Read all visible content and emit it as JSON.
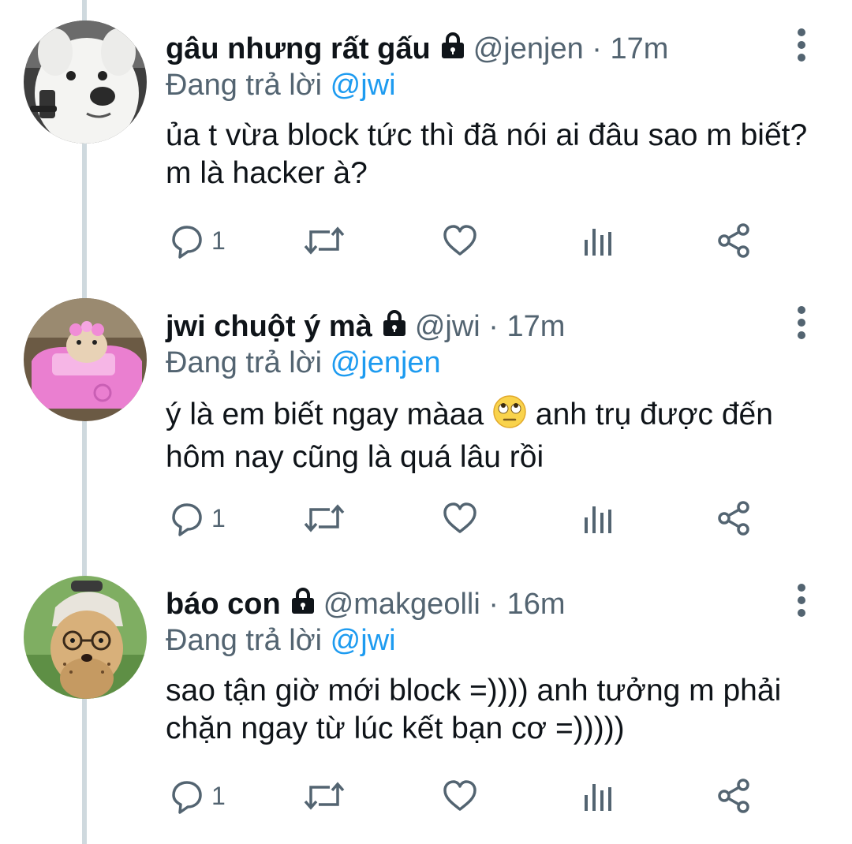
{
  "tweets": [
    {
      "name": "gâu nhưng rất gấu",
      "handle": "@jenjen",
      "separator": "·",
      "time": "17m",
      "replying_prefix": "Đang trả lời",
      "replying_to": "@jwi",
      "text_before_emoji": "ủa t vừa block tức thì đã nói ai đâu sao m biết? m là hacker à?",
      "text_after_emoji": "",
      "avatar_icon": "samoyed-dog-avatar",
      "reply_count": "1"
    },
    {
      "name": "jwi chuột ý mà",
      "handle": "@jwi",
      "separator": "·",
      "time": "17m",
      "replying_prefix": "Đang trả lời",
      "replying_to": "@jenjen",
      "text_before_emoji": "ý là em biết ngay màaa",
      "text_after_emoji": "anh trụ được đến hôm nay cũng là quá lâu rồi",
      "emoji": "eye-roll-emoji",
      "avatar_icon": "hamster-pink-car-avatar",
      "reply_count": "1"
    },
    {
      "name": "báo con",
      "handle": "@makgeolli",
      "separator": "·",
      "time": "16m",
      "replying_prefix": "Đang trả lời",
      "replying_to": "@jwi",
      "text_before_emoji": "sao tận giờ mới block =)))) anh tưởng m phải chặn ngay từ lúc kết bạn cơ =)))))",
      "text_after_emoji": "",
      "avatar_icon": "cheetah-cub-cap-avatar",
      "reply_count": "1"
    }
  ],
  "icons": {
    "lock": "lock-icon",
    "menu": "more-vertical-icon",
    "reply": "reply-icon",
    "retweet": "retweet-icon",
    "like": "heart-icon",
    "analytics": "analytics-icon",
    "share": "share-icon"
  },
  "colors": {
    "text_primary": "#0f1419",
    "text_secondary": "#536471",
    "mention_blue": "#1d9bf0",
    "thread_line": "#cfd9de"
  }
}
